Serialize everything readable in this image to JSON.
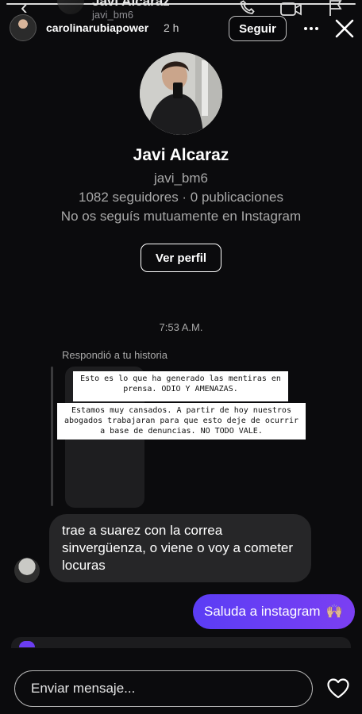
{
  "ghost_header": {
    "title": "Javi Alcaraz",
    "subtitle": "javi_bm6"
  },
  "story_header": {
    "username": "carolinarubiapower",
    "time": "2 h",
    "follow_label": "Seguir"
  },
  "profile": {
    "name": "Javi Alcaraz",
    "handle": "javi_bm6",
    "stats": "1082 seguidores · 0 publicaciones",
    "mutual": "No os seguís mutuamente en Instagram",
    "view_profile_label": "Ver perfil"
  },
  "chat": {
    "timestamp": "7:53 A.M.",
    "replied_label": "Respondió a tu historia",
    "story_text_1": "Esto es lo que ha generado las mentiras en prensa. ODIO Y AMENAZAS.",
    "story_text_2": "Estamos muy cansados. A partir de hoy nuestros abogados trabajaran para que esto deje de ocurrir a base de denuncias. NO TODO VALE.",
    "incoming_message": "trae a suarez con la correa sinvergüenza, o viene o voy a cometer locuras",
    "outgoing_message": "Saluda a instagram",
    "outgoing_emoji": "🙌🏼"
  },
  "composer": {
    "placeholder": "Enviar mensaje..."
  },
  "icons": {
    "back": "chevron-left-icon",
    "phone": "phone-icon",
    "video": "video-camera-icon",
    "flag": "flag-icon",
    "more": "more-dots-icon",
    "close": "close-icon",
    "heart": "heart-icon"
  },
  "colors": {
    "background": "#0b0b0d",
    "incoming_bubble": "#262628",
    "outgoing_bubble_start": "#5b3df5",
    "outgoing_bubble_end": "#7b3ff2"
  }
}
